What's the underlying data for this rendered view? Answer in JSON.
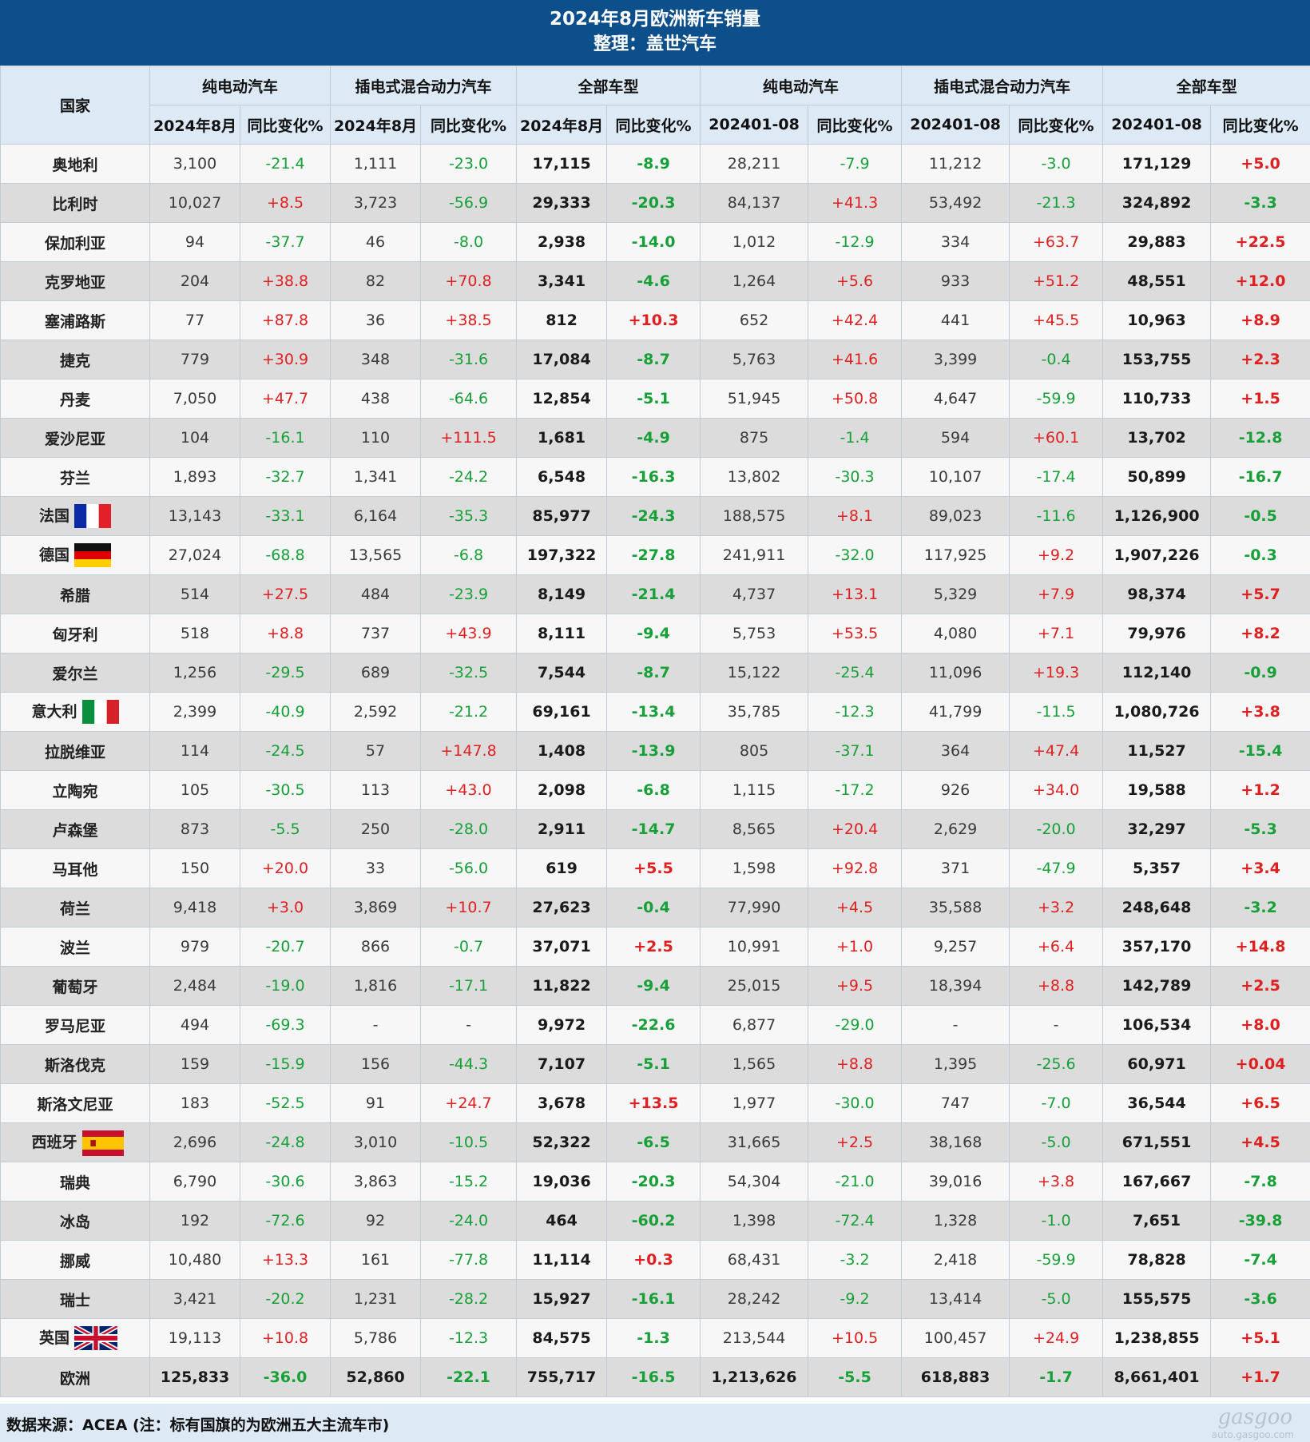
{
  "title": "2024年8月欧洲新车销量",
  "subtitle": "整理：盖世汽车",
  "header": {
    "country": "国家",
    "groups": [
      "纯电动汽车",
      "插电式混合动力汽车",
      "全部车型",
      "纯电动汽车",
      "插电式混合动力汽车",
      "全部车型"
    ],
    "sub": [
      "2024年8月",
      "同比变化%",
      "2024年8月",
      "同比变化%",
      "2024年8月",
      "同比变化%",
      "202401-08",
      "同比变化%",
      "202401-08",
      "同比变化%",
      "202401-08",
      "同比变化%"
    ]
  },
  "rows": [
    {
      "country": "奥地利",
      "flag": "",
      "v": [
        "3,100",
        "-21.4",
        "1,111",
        "-23.0",
        "17,115",
        "-8.9",
        "28,211",
        "-7.9",
        "11,212",
        "-3.0",
        "171,129",
        "+5.0"
      ]
    },
    {
      "country": "比利时",
      "flag": "",
      "v": [
        "10,027",
        "+8.5",
        "3,723",
        "-56.9",
        "29,333",
        "-20.3",
        "84,137",
        "+41.3",
        "53,492",
        "-21.3",
        "324,892",
        "-3.3"
      ]
    },
    {
      "country": "保加利亚",
      "flag": "",
      "v": [
        "94",
        "-37.7",
        "46",
        "-8.0",
        "2,938",
        "-14.0",
        "1,012",
        "-12.9",
        "334",
        "+63.7",
        "29,883",
        "+22.5"
      ]
    },
    {
      "country": "克罗地亚",
      "flag": "",
      "v": [
        "204",
        "+38.8",
        "82",
        "+70.8",
        "3,341",
        "-4.6",
        "1,264",
        "+5.6",
        "933",
        "+51.2",
        "48,551",
        "+12.0"
      ]
    },
    {
      "country": "塞浦路斯",
      "flag": "",
      "v": [
        "77",
        "+87.8",
        "36",
        "+38.5",
        "812",
        "+10.3",
        "652",
        "+42.4",
        "441",
        "+45.5",
        "10,963",
        "+8.9"
      ]
    },
    {
      "country": "捷克",
      "flag": "",
      "v": [
        "779",
        "+30.9",
        "348",
        "-31.6",
        "17,084",
        "-8.7",
        "5,763",
        "+41.6",
        "3,399",
        "-0.4",
        "153,755",
        "+2.3"
      ]
    },
    {
      "country": "丹麦",
      "flag": "",
      "v": [
        "7,050",
        "+47.7",
        "438",
        "-64.6",
        "12,854",
        "-5.1",
        "51,945",
        "+50.8",
        "4,647",
        "-59.9",
        "110,733",
        "+1.5"
      ]
    },
    {
      "country": "爱沙尼亚",
      "flag": "",
      "v": [
        "104",
        "-16.1",
        "110",
        "+111.5",
        "1,681",
        "-4.9",
        "875",
        "-1.4",
        "594",
        "+60.1",
        "13,702",
        "-12.8"
      ]
    },
    {
      "country": "芬兰",
      "flag": "",
      "v": [
        "1,893",
        "-32.7",
        "1,341",
        "-24.2",
        "6,548",
        "-16.3",
        "13,802",
        "-30.3",
        "10,107",
        "-17.4",
        "50,899",
        "-16.7"
      ]
    },
    {
      "country": "法国",
      "flag": "france-flag",
      "v": [
        "13,143",
        "-33.1",
        "6,164",
        "-35.3",
        "85,977",
        "-24.3",
        "188,575",
        "+8.1",
        "89,023",
        "-11.6",
        "1,126,900",
        "-0.5"
      ]
    },
    {
      "country": "德国",
      "flag": "germany-flag",
      "v": [
        "27,024",
        "-68.8",
        "13,565",
        "-6.8",
        "197,322",
        "-27.8",
        "241,911",
        "-32.0",
        "117,925",
        "+9.2",
        "1,907,226",
        "-0.3"
      ]
    },
    {
      "country": "希腊",
      "flag": "",
      "v": [
        "514",
        "+27.5",
        "484",
        "-23.9",
        "8,149",
        "-21.4",
        "4,737",
        "+13.1",
        "5,329",
        "+7.9",
        "98,374",
        "+5.7"
      ]
    },
    {
      "country": "匈牙利",
      "flag": "",
      "v": [
        "518",
        "+8.8",
        "737",
        "+43.9",
        "8,111",
        "-9.4",
        "5,753",
        "+53.5",
        "4,080",
        "+7.1",
        "79,976",
        "+8.2"
      ]
    },
    {
      "country": "爱尔兰",
      "flag": "",
      "v": [
        "1,256",
        "-29.5",
        "689",
        "-32.5",
        "7,544",
        "-8.7",
        "15,122",
        "-25.4",
        "11,096",
        "+19.3",
        "112,140",
        "-0.9"
      ]
    },
    {
      "country": "意大利",
      "flag": "italy-flag",
      "v": [
        "2,399",
        "-40.9",
        "2,592",
        "-21.2",
        "69,161",
        "-13.4",
        "35,785",
        "-12.3",
        "41,799",
        "-11.5",
        "1,080,726",
        "+3.8"
      ]
    },
    {
      "country": "拉脱维亚",
      "flag": "",
      "v": [
        "114",
        "-24.5",
        "57",
        "+147.8",
        "1,408",
        "-13.9",
        "805",
        "-37.1",
        "364",
        "+47.4",
        "11,527",
        "-15.4"
      ]
    },
    {
      "country": "立陶宛",
      "flag": "",
      "v": [
        "105",
        "-30.5",
        "113",
        "+43.0",
        "2,098",
        "-6.8",
        "1,115",
        "-17.2",
        "926",
        "+34.0",
        "19,588",
        "+1.2"
      ]
    },
    {
      "country": "卢森堡",
      "flag": "",
      "v": [
        "873",
        "-5.5",
        "250",
        "-28.0",
        "2,911",
        "-14.7",
        "8,565",
        "+20.4",
        "2,629",
        "-20.0",
        "32,297",
        "-5.3"
      ]
    },
    {
      "country": "马耳他",
      "flag": "",
      "v": [
        "150",
        "+20.0",
        "33",
        "-56.0",
        "619",
        "+5.5",
        "1,598",
        "+92.8",
        "371",
        "-47.9",
        "5,357",
        "+3.4"
      ]
    },
    {
      "country": "荷兰",
      "flag": "",
      "v": [
        "9,418",
        "+3.0",
        "3,869",
        "+10.7",
        "27,623",
        "-0.4",
        "77,990",
        "+4.5",
        "35,588",
        "+3.2",
        "248,648",
        "-3.2"
      ]
    },
    {
      "country": "波兰",
      "flag": "",
      "v": [
        "979",
        "-20.7",
        "866",
        "-0.7",
        "37,071",
        "+2.5",
        "10,991",
        "+1.0",
        "9,257",
        "+6.4",
        "357,170",
        "+14.8"
      ]
    },
    {
      "country": "葡萄牙",
      "flag": "",
      "v": [
        "2,484",
        "-19.0",
        "1,816",
        "-17.1",
        "11,822",
        "-9.4",
        "25,015",
        "+9.5",
        "18,394",
        "+8.8",
        "142,789",
        "+2.5"
      ]
    },
    {
      "country": "罗马尼亚",
      "flag": "",
      "v": [
        "494",
        "-69.3",
        "-",
        "-",
        "9,972",
        "-22.6",
        "6,877",
        "-29.0",
        "-",
        "-",
        "106,534",
        "+8.0"
      ]
    },
    {
      "country": "斯洛伐克",
      "flag": "",
      "v": [
        "159",
        "-15.9",
        "156",
        "-44.3",
        "7,107",
        "-5.1",
        "1,565",
        "+8.8",
        "1,395",
        "-25.6",
        "60,971",
        "+0.04"
      ]
    },
    {
      "country": "斯洛文尼亚",
      "flag": "",
      "v": [
        "183",
        "-52.5",
        "91",
        "+24.7",
        "3,678",
        "+13.5",
        "1,977",
        "-30.0",
        "747",
        "-7.0",
        "36,544",
        "+6.5"
      ]
    },
    {
      "country": "西班牙",
      "flag": "spain-flag",
      "v": [
        "2,696",
        "-24.8",
        "3,010",
        "-10.5",
        "52,322",
        "-6.5",
        "31,665",
        "+2.5",
        "38,168",
        "-5.0",
        "671,551",
        "+4.5"
      ]
    },
    {
      "country": "瑞典",
      "flag": "",
      "v": [
        "6,790",
        "-30.6",
        "3,863",
        "-15.2",
        "19,036",
        "-20.3",
        "54,304",
        "-21.0",
        "39,016",
        "+3.8",
        "167,667",
        "-7.8"
      ]
    },
    {
      "country": "冰岛",
      "flag": "",
      "v": [
        "192",
        "-72.6",
        "92",
        "-24.0",
        "464",
        "-60.2",
        "1,398",
        "-72.4",
        "1,328",
        "-1.0",
        "7,651",
        "-39.8"
      ]
    },
    {
      "country": "挪威",
      "flag": "",
      "v": [
        "10,480",
        "+13.3",
        "161",
        "-77.8",
        "11,114",
        "+0.3",
        "68,431",
        "-3.2",
        "2,418",
        "-59.9",
        "78,828",
        "-7.4"
      ]
    },
    {
      "country": "瑞士",
      "flag": "",
      "v": [
        "3,421",
        "-20.2",
        "1,231",
        "-28.2",
        "15,927",
        "-16.1",
        "28,242",
        "-9.2",
        "13,414",
        "-5.0",
        "155,575",
        "-3.6"
      ]
    },
    {
      "country": "英国",
      "flag": "uk-flag",
      "v": [
        "19,113",
        "+10.8",
        "5,786",
        "-12.3",
        "84,575",
        "-1.3",
        "213,544",
        "+10.5",
        "100,457",
        "+24.9",
        "1,238,855",
        "+5.1"
      ]
    },
    {
      "country": "欧洲",
      "flag": "",
      "total": true,
      "v": [
        "125,833",
        "-36.0",
        "52,860",
        "-22.1",
        "755,717",
        "-16.5",
        "1,213,626",
        "-5.5",
        "618,883",
        "-1.7",
        "8,661,401",
        "+1.7"
      ]
    }
  ],
  "footer": {
    "source": "数据来源：ACEA (注：标有国旗的为欧洲五大主流车市)",
    "watermark": "gasgoo",
    "watermark_url": "auto.gasgoo.com"
  },
  "colors": {
    "header_bg": "#0d4f8b",
    "positive": "#e02020",
    "negative": "#18a038",
    "subheader_bg": "#dde9f5"
  }
}
